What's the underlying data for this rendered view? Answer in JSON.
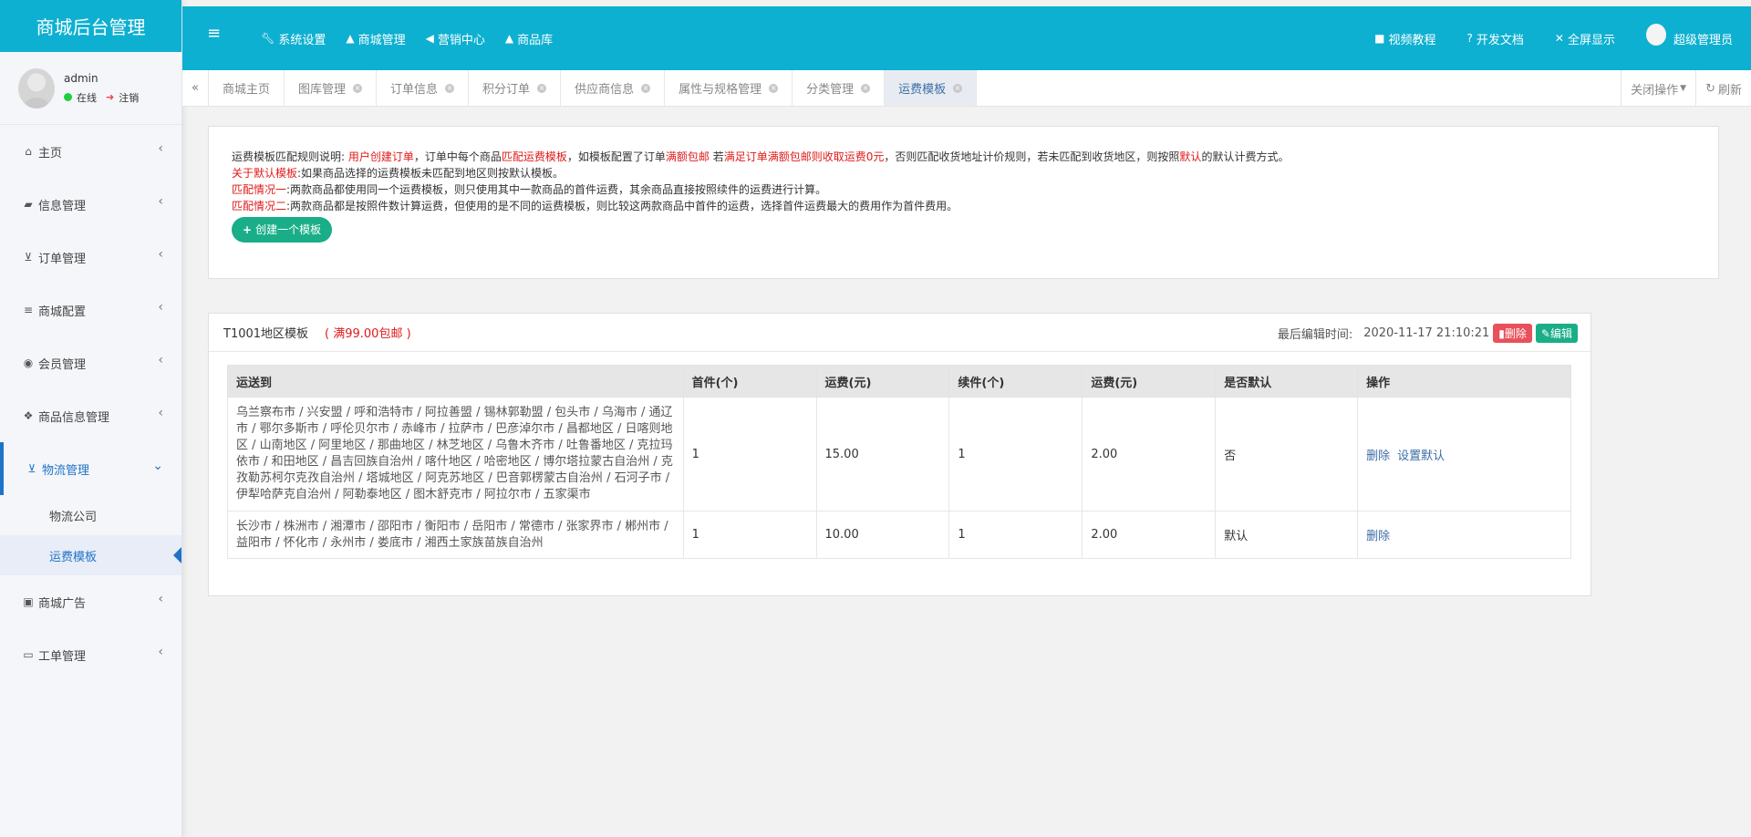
{
  "sidebar": {
    "title": "商城后台管理",
    "user": {
      "name": "admin",
      "status": "在线",
      "logout": "注销"
    },
    "items": [
      {
        "label": "主页",
        "icon": "home-icon"
      },
      {
        "label": "信息管理",
        "icon": "folder-icon"
      },
      {
        "label": "订单管理",
        "icon": "cart-icon"
      },
      {
        "label": "商城配置",
        "icon": "list-icon"
      },
      {
        "label": "会员管理",
        "icon": "user-circle-icon"
      },
      {
        "label": "商品信息管理",
        "icon": "cubes-icon"
      },
      {
        "label": "物流管理",
        "icon": "cart-icon"
      },
      {
        "label": "商城广告",
        "icon": "image-icon"
      },
      {
        "label": "工单管理",
        "icon": "desktop-icon"
      }
    ],
    "sub_items": [
      {
        "label": "物流公司"
      },
      {
        "label": "运费模板"
      }
    ]
  },
  "topbar": {
    "nav": [
      {
        "label": "系统设置",
        "icon": "wrench-icon"
      },
      {
        "label": "商城管理",
        "icon": "shopping-bag-icon"
      },
      {
        "label": "营销中心",
        "icon": "bullhorn-icon"
      },
      {
        "label": "商品库",
        "icon": "shopping-bag-icon"
      }
    ],
    "right": [
      {
        "label": "视频教程",
        "icon": "video-icon"
      },
      {
        "label": "开发文档",
        "icon": "question-icon"
      },
      {
        "label": "全屏显示",
        "icon": "fullscreen-icon"
      },
      {
        "label": "超级管理员",
        "icon": "avatar"
      }
    ]
  },
  "tabs": {
    "items": [
      {
        "label": "商城主页"
      },
      {
        "label": "图库管理"
      },
      {
        "label": "订单信息"
      },
      {
        "label": "积分订单"
      },
      {
        "label": "供应商信息"
      },
      {
        "label": "属性与规格管理"
      },
      {
        "label": "分类管理"
      },
      {
        "label": "运费模板"
      }
    ],
    "close_ops": "关闭操作",
    "refresh": "刷新"
  },
  "info": {
    "l1": {
      "a": "运费模板匹配规则说明: ",
      "b": "用户创建订单",
      "c": "，订单中每个商品",
      "d": "匹配运费模板",
      "e": "，如模板配置了订单",
      "f": "满额包邮",
      "g": " 若",
      "h": "满足订单满额包邮则收取运费0元",
      "i": "，否则匹配收货地址计价规则，若未匹配到收货地区，则按照",
      "j": "默认",
      "k": "的默认计费方式。"
    },
    "l2": {
      "a": "关于默认模板",
      "b": ":如果商品选择的运费模板未匹配到地区则按默认模板。"
    },
    "l3": {
      "a": "匹配情况一",
      "b": ":两款商品都使用同一个运费模板，则只使用其中一款商品的首件运费，其余商品直接按照续件的运费进行计算。"
    },
    "l4": {
      "a": "匹配情况二",
      "b": ":两款商品都是按照件数计算运费，但使用的是不同的运费模板，则比较这两款商品中首件的运费，选择首件运费最大的费用作为首件费用。"
    },
    "create_button": "创建一个模板"
  },
  "template": {
    "name": "T1001地区模板",
    "free_shipping": "( 满99.00包邮 )",
    "edit_time_label": "最后编辑时间:",
    "edit_time": "2020-11-17 21:10:21",
    "delete_label": "删除",
    "edit_label": "编辑",
    "headers": [
      "运送到",
      "首件(个)",
      "运费(元)",
      "续件(个)",
      "运费(元)",
      "是否默认",
      "操作"
    ],
    "rows": [
      {
        "regions": "乌兰察布市 / 兴安盟 / 呼和浩特市 / 阿拉善盟 / 锡林郭勒盟 / 包头市 / 乌海市 / 通辽市 / 鄂尔多斯市 / 呼伦贝尔市 / 赤峰市 / 拉萨市 / 巴彦淖尔市 / 昌都地区 / 日喀则地区 / 山南地区 / 阿里地区 / 那曲地区 / 林芝地区 / 乌鲁木齐市 / 吐鲁番地区 / 克拉玛依市 / 和田地区 / 昌吉回族自治州 / 喀什地区 / 哈密地区 / 博尔塔拉蒙古自治州 / 克孜勒苏柯尔克孜自治州 / 塔城地区 / 阿克苏地区 / 巴音郭楞蒙古自治州 / 石河子市 / 伊犁哈萨克自治州 / 阿勒泰地区 / 图木舒克市 / 阿拉尔市 / 五家渠市",
        "first": "1",
        "first_fee": "15.00",
        "next": "1",
        "next_fee": "2.00",
        "is_default": "否",
        "actions": [
          "删除",
          "设置默认"
        ]
      },
      {
        "regions": "长沙市 / 株洲市 / 湘潭市 / 邵阳市 / 衡阳市 / 岳阳市 / 常德市 / 张家界市 / 郴州市 / 益阳市 / 怀化市 / 永州市 / 娄底市 / 湘西土家族苗族自治州",
        "first": "1",
        "first_fee": "10.00",
        "next": "1",
        "next_fee": "2.00",
        "is_default": "默认",
        "actions": [
          "删除"
        ]
      }
    ]
  }
}
